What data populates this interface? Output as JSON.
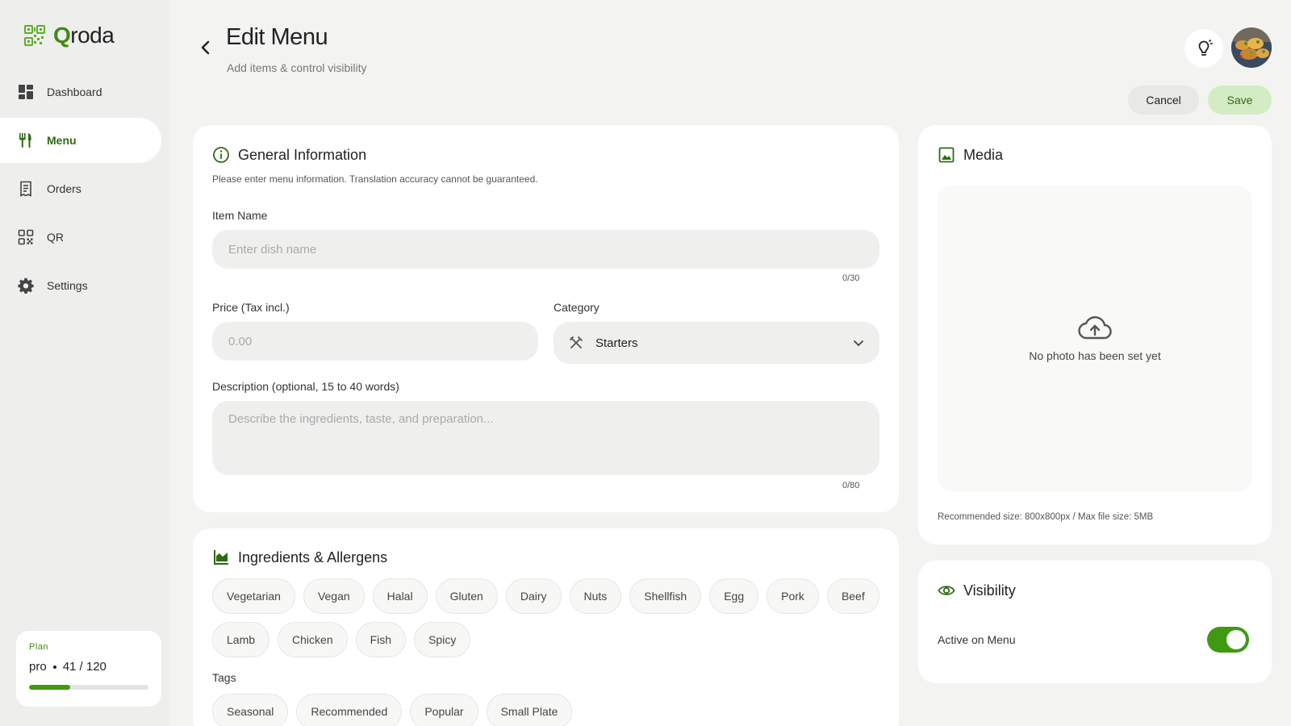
{
  "app": {
    "name_first": "Q",
    "name_rest": "roda"
  },
  "nav": [
    {
      "label": "Dashboard",
      "icon": "dashboard-icon"
    },
    {
      "label": "Menu",
      "icon": "utensils-icon",
      "active": true
    },
    {
      "label": "Orders",
      "icon": "receipt-icon"
    },
    {
      "label": "QR",
      "icon": "qr-icon"
    },
    {
      "label": "Settings",
      "icon": "gear-icon"
    }
  ],
  "plan": {
    "label": "Plan",
    "tier": "pro",
    "usage": "41 / 120",
    "used": 41,
    "limit": 120
  },
  "header": {
    "title": "Edit Menu",
    "subtitle": "Add items & control visibility",
    "cancel_label": "Cancel",
    "save_label": "Save"
  },
  "general": {
    "title": "General Information",
    "note": "Please enter menu information. Translation accuracy cannot be guaranteed.",
    "item_name_label": "Item Name",
    "item_name_placeholder": "Enter dish name",
    "item_name_counter": "0/30",
    "price_label": "Price (Tax incl.)",
    "price_placeholder": "0.00",
    "category_label": "Category",
    "category_value": "Starters",
    "description_label": "Description (optional, 15 to 40 words)",
    "description_placeholder": "Describe the ingredients, taste, and preparation...",
    "description_counter": "0/80"
  },
  "ingredients": {
    "title": "Ingredients & Allergens",
    "chips": [
      "Vegetarian",
      "Vegan",
      "Halal",
      "Gluten",
      "Dairy",
      "Nuts",
      "Shellfish",
      "Egg",
      "Pork",
      "Beef",
      "Lamb",
      "Chicken",
      "Fish",
      "Spicy"
    ],
    "tags_label": "Tags",
    "tags": [
      "Seasonal",
      "Recommended",
      "Popular",
      "Small Plate"
    ]
  },
  "media": {
    "title": "Media",
    "empty_text": "No photo has been set yet",
    "hint": "Recommended size: 800x800px / Max file size: 5MB"
  },
  "visibility": {
    "title": "Visibility",
    "active_label": "Active on Menu",
    "active": true
  },
  "colors": {
    "accent": "#3f9a12",
    "accent_dark": "#2e6b12",
    "save_bg": "#d4ecc3"
  }
}
